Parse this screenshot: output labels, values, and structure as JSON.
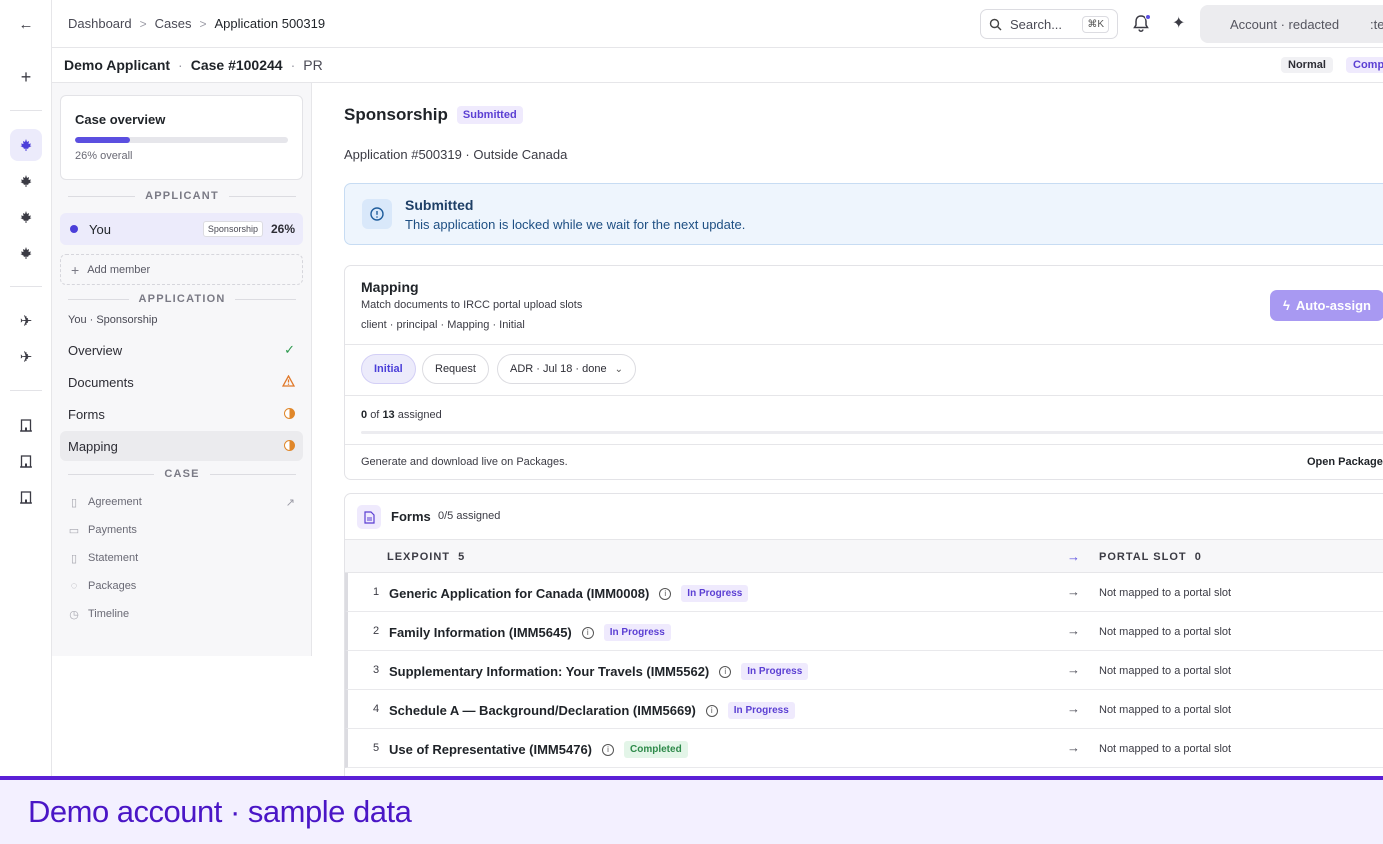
{
  "rail": {
    "back_icon": "arrow-left-icon",
    "new_icon": "plus-icon",
    "items": [
      "maple-leaf-icon",
      "maple-leaf-icon",
      "maple-leaf-icon",
      "maple-leaf-icon",
      "plane-icon",
      "plane-icon",
      "building-icon",
      "building-icon",
      "building-icon"
    ]
  },
  "topbar": {
    "crumbs": [
      "Dashboard",
      "Cases",
      "Application 500319"
    ],
    "search_label": "Search...",
    "search_kbd": "⌘K",
    "account": "Account · redacted",
    "account_extra": ":te"
  },
  "subheader": {
    "applicant": "Demo Applicant",
    "case": "Case #100244",
    "program": "PR",
    "priority": "Normal",
    "status_cut": "Comp"
  },
  "sidebar": {
    "overview_title": "Case overview",
    "overview_progress": 0.26,
    "overview_sub": "26% overall",
    "applicant_head": "APPLICANT",
    "member": {
      "name": "You",
      "tag": "Sponsorship",
      "pct": "26%"
    },
    "add_member": "Add member",
    "application_head": "APPLICATION",
    "application_sub": "You · Sponsorship",
    "nav": [
      {
        "label": "Overview",
        "status": "check"
      },
      {
        "label": "Documents",
        "status": "warning"
      },
      {
        "label": "Forms",
        "status": "half"
      },
      {
        "label": "Mapping",
        "status": "half"
      }
    ],
    "case_head": "CASE",
    "case_items": [
      {
        "label": "Agreement",
        "icon": "file-icon"
      },
      {
        "label": "Payments",
        "icon": "card-icon"
      },
      {
        "label": "Statement",
        "icon": "file-icon"
      },
      {
        "label": "Packages",
        "icon": "check-circle-icon"
      },
      {
        "label": "Timeline",
        "icon": "clock-icon"
      }
    ]
  },
  "main": {
    "title": "Sponsorship",
    "title_badge": "Submitted",
    "app_line": "Application #500319 · Outside Canada",
    "banner": {
      "title": "Submitted",
      "text": "This application is locked while we wait for the next update."
    },
    "mapping": {
      "title": "Mapping",
      "subtitle": "Match documents to IRCC portal upload slots",
      "crumb": "client · principal · Mapping · Initial",
      "auto_assign": "Auto-assign",
      "chips": [
        "Initial",
        "Request",
        "ADR · Jul 18 · done"
      ],
      "assigned_count": "0",
      "assigned_of": "of",
      "assigned_total": "13",
      "assigned_word": "assigned",
      "assigned_pct": "0%",
      "assigned_fraction": 0,
      "generate_text": "Generate and download live on Packages.",
      "open_packages": "Open Packages →"
    },
    "forms": {
      "title": "Forms",
      "assigned": "0/5 assigned",
      "col_left": "LEXPOINT",
      "col_left_count": "5",
      "col_right": "PORTAL SLOT",
      "col_right_count": "0",
      "rows": [
        {
          "num": "1",
          "name": "Generic Application for Canada (IMM0008)",
          "status": "In Progress",
          "slot": "Not mapped to a portal slot"
        },
        {
          "num": "2",
          "name": "Family Information (IMM5645)",
          "status": "In Progress",
          "slot": "Not mapped to a portal slot"
        },
        {
          "num": "3",
          "name": "Supplementary Information: Your Travels (IMM5562)",
          "status": "In Progress",
          "slot": "Not mapped to a portal slot"
        },
        {
          "num": "4",
          "name": "Schedule A — Background/Declaration (IMM5669)",
          "status": "In Progress",
          "slot": "Not mapped to a portal slot"
        },
        {
          "num": "5",
          "name": "Use of Representative (IMM5476)",
          "status": "Completed",
          "slot": "Not mapped to a portal slot"
        }
      ]
    }
  },
  "demo_banner": "Demo account · sample data",
  "colors": {
    "accent": "#5b4fe0",
    "banner_bg": "#eef5fd",
    "demo": "#4a16c6"
  }
}
